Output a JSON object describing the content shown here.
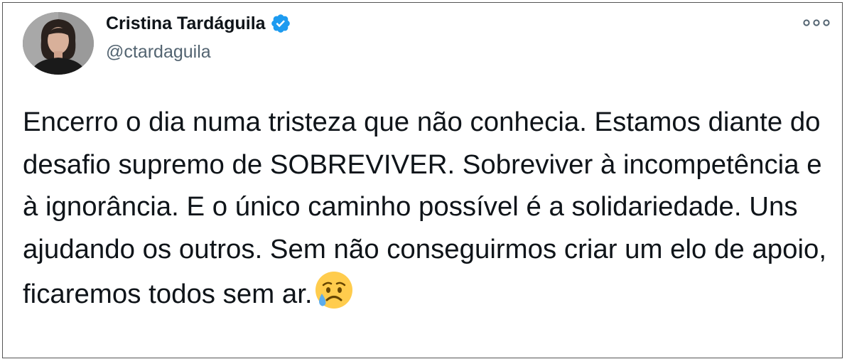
{
  "author": {
    "display_name": "Cristina Tardáguila",
    "handle": "@ctardaguila",
    "verified_icon": "verified-badge-icon",
    "verified_color": "#1d9bf0"
  },
  "more_icon": "more-options-icon",
  "tweet": {
    "text": "Encerro o dia numa tristeza que não conhecia. Estamos diante do desafio supremo de SOBREVIVER. Sobreviver à incompetência e à ignorância. E o único caminho possível é a solidariedade. Uns ajudando os outros. Sem não conseguirmos criar um elo de apoio, ficaremos todos sem ar.",
    "emoji_icon": "sad-but-relieved-face-icon"
  },
  "colors": {
    "text": "#0f1419",
    "secondary": "#536471",
    "border": "#555555"
  }
}
